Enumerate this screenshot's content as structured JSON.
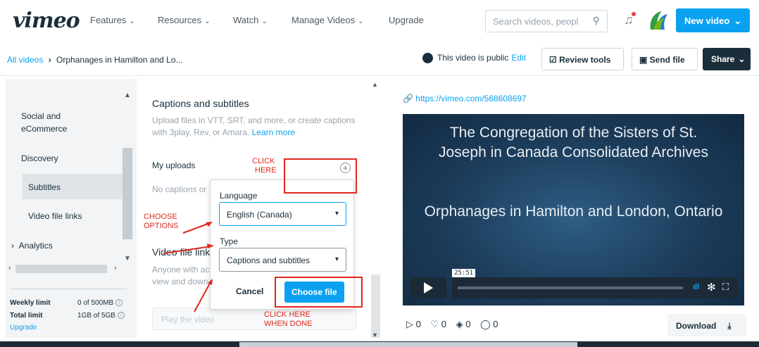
{
  "nav": {
    "logo": "vimeo",
    "items": [
      {
        "label": "Features"
      },
      {
        "label": "Resources"
      },
      {
        "label": "Watch"
      },
      {
        "label": "Manage Videos"
      },
      {
        "label": "Upgrade"
      }
    ],
    "chevron": "⌄",
    "search_placeholder": "Search videos, peopl",
    "new_video": "New video"
  },
  "breadcrumb": {
    "root": "All videos",
    "separator": "›",
    "current": "Orphanages in Hamilton and Lo..."
  },
  "privacy": {
    "text": "This video is public",
    "edit": "Edit"
  },
  "toolbar": {
    "review": "Review tools",
    "send": "Send file",
    "share": "Share"
  },
  "sidebar": {
    "items": [
      {
        "label": "Social and eCommerce"
      },
      {
        "label": "Discovery"
      },
      {
        "label": "Subtitles"
      },
      {
        "label": "Video file links"
      },
      {
        "label": "Analytics"
      }
    ],
    "weekly_limit_label": "Weekly limit",
    "weekly_limit_value": "0 of 500MB",
    "total_limit_label": "Total limit",
    "total_limit_value": "1GB of 5GB",
    "upgrade": "Upgrade"
  },
  "main": {
    "captions_title": "Captions and subtitles",
    "captions_desc": "Upload files in VTT, SRT, and more, or create captions with 3play, Rev, or Amara.",
    "learn_more": "Learn more",
    "my_uploads": "My uploads",
    "no_captions": "No captions or",
    "video_file_links_title": "Video file link",
    "video_file_links_desc1": "Anyone with ac",
    "video_file_links_desc2": "view and down",
    "play_select": "Play the video"
  },
  "popup": {
    "language_label": "Language",
    "language_value": "English (Canada)",
    "type_label": "Type",
    "type_value": "Captions and subtitles",
    "cancel": "Cancel",
    "choose_file": "Choose file"
  },
  "annotations": {
    "click_here_1": "CLICK",
    "click_here_2": "HERE",
    "choose_1": "CHOOSE",
    "choose_2": "OPTIONS",
    "done_1": "CLICK HERE",
    "done_2": "WHEN DONE"
  },
  "video": {
    "url": "https://vimeo.com/568608697",
    "title_line1": "The Congregation of the Sisters of St.",
    "title_line2": "Joseph in Canada Consolidated Archives",
    "subtitle": "Orphanages in Hamilton and London, Ontario",
    "timestamp": "25:51",
    "progress_fraction": 0.0
  },
  "stats": {
    "plays": "0",
    "likes": "0",
    "collections": "0",
    "comments": "0"
  },
  "download": "Download",
  "colors": {
    "accent": "#0aa2f0",
    "annotation": "#e0281e",
    "dark": "#1a2e3b"
  }
}
